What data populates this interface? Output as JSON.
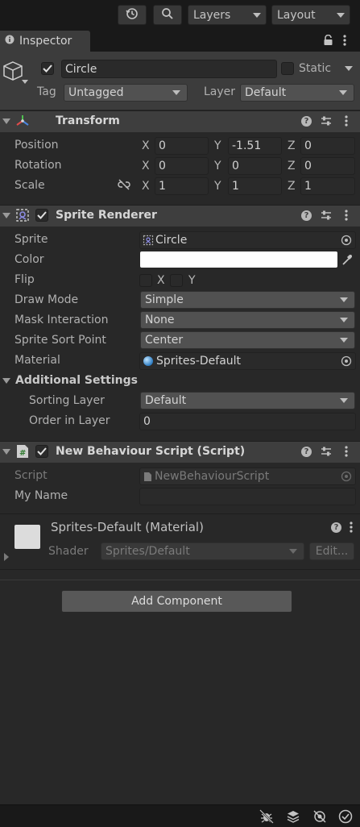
{
  "toolbar": {
    "layers_label": "Layers",
    "layout_label": "Layout",
    "history_icon": "history-icon",
    "search_icon": "search-icon"
  },
  "tab": {
    "label": "Inspector"
  },
  "object": {
    "name": "Circle",
    "static_label": "Static",
    "tag_label": "Tag",
    "tag_value": "Untagged",
    "layer_label": "Layer",
    "layer_value": "Default"
  },
  "transform": {
    "title": "Transform",
    "rows": [
      {
        "label": "Position",
        "x": "0",
        "y": "-1.51",
        "z": "0"
      },
      {
        "label": "Rotation",
        "x": "0",
        "y": "0",
        "z": "0"
      },
      {
        "label": "Scale",
        "x": "1",
        "y": "1",
        "z": "1"
      }
    ],
    "axis": {
      "x": "X",
      "y": "Y",
      "z": "Z"
    }
  },
  "sprite_renderer": {
    "title": "Sprite Renderer",
    "sprite_label": "Sprite",
    "sprite_value": "Circle",
    "color_label": "Color",
    "color_value": "#ffffff",
    "flip_label": "Flip",
    "flip_x": "X",
    "flip_y": "Y",
    "draw_mode_label": "Draw Mode",
    "draw_mode_value": "Simple",
    "mask_label": "Mask Interaction",
    "mask_value": "None",
    "sort_point_label": "Sprite Sort Point",
    "sort_point_value": "Center",
    "material_label": "Material",
    "material_value": "Sprites-Default",
    "additional_label": "Additional Settings",
    "sorting_layer_label": "Sorting Layer",
    "sorting_layer_value": "Default",
    "order_label": "Order in Layer",
    "order_value": "0"
  },
  "script": {
    "title": "New Behaviour Script (Script)",
    "script_label": "Script",
    "script_value": "NewBehaviourScript",
    "my_name_label": "My Name",
    "my_name_value": ""
  },
  "material": {
    "title": "Sprites-Default (Material)",
    "shader_label": "Shader",
    "shader_value": "Sprites/Default",
    "edit_label": "Edit..."
  },
  "add_component": {
    "label": "Add Component"
  },
  "colors": {
    "background": "#282828",
    "panel": "#3c3c3c",
    "field": "#2a2a2a"
  }
}
